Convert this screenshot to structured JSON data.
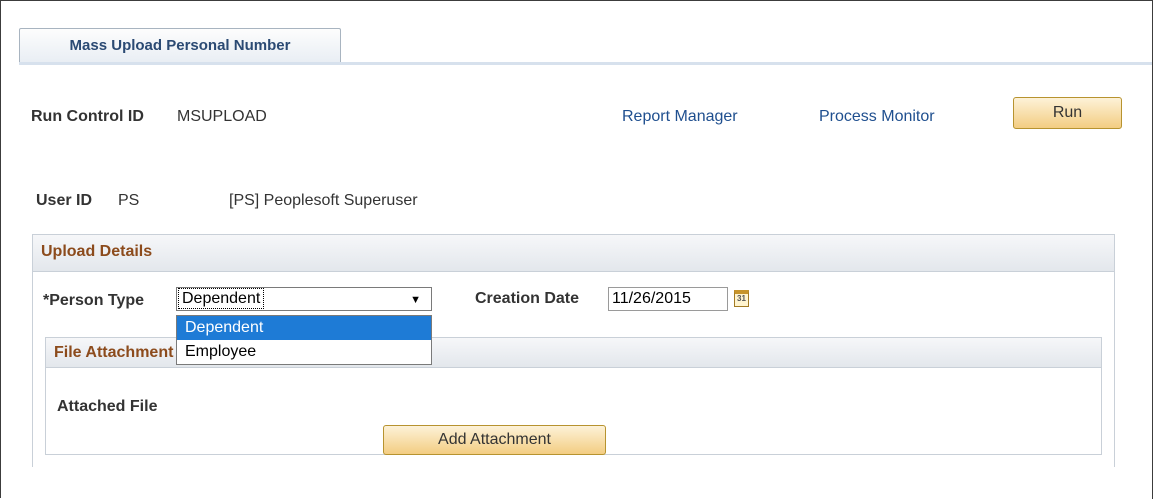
{
  "tab": {
    "label": "Mass Upload Personal Number"
  },
  "run_control": {
    "label": "Run Control ID",
    "value": "MSUPLOAD"
  },
  "links": {
    "report_manager": "Report Manager",
    "process_monitor": "Process Monitor"
  },
  "run_button": {
    "label": "Run"
  },
  "user": {
    "label": "User ID",
    "value": "PS",
    "description": "[PS] Peoplesoft Superuser"
  },
  "upload_details": {
    "title": "Upload Details",
    "person_type": {
      "label": "*Person Type",
      "value": "Dependent",
      "options": [
        "Dependent",
        "Employee"
      ]
    },
    "creation_date": {
      "label": "Creation Date",
      "value": "11/26/2015",
      "calendar_glyph": "31"
    }
  },
  "file_attachment": {
    "title": "File Attachment",
    "attached_file_label": "Attached File",
    "add_button": "Add Attachment"
  }
}
